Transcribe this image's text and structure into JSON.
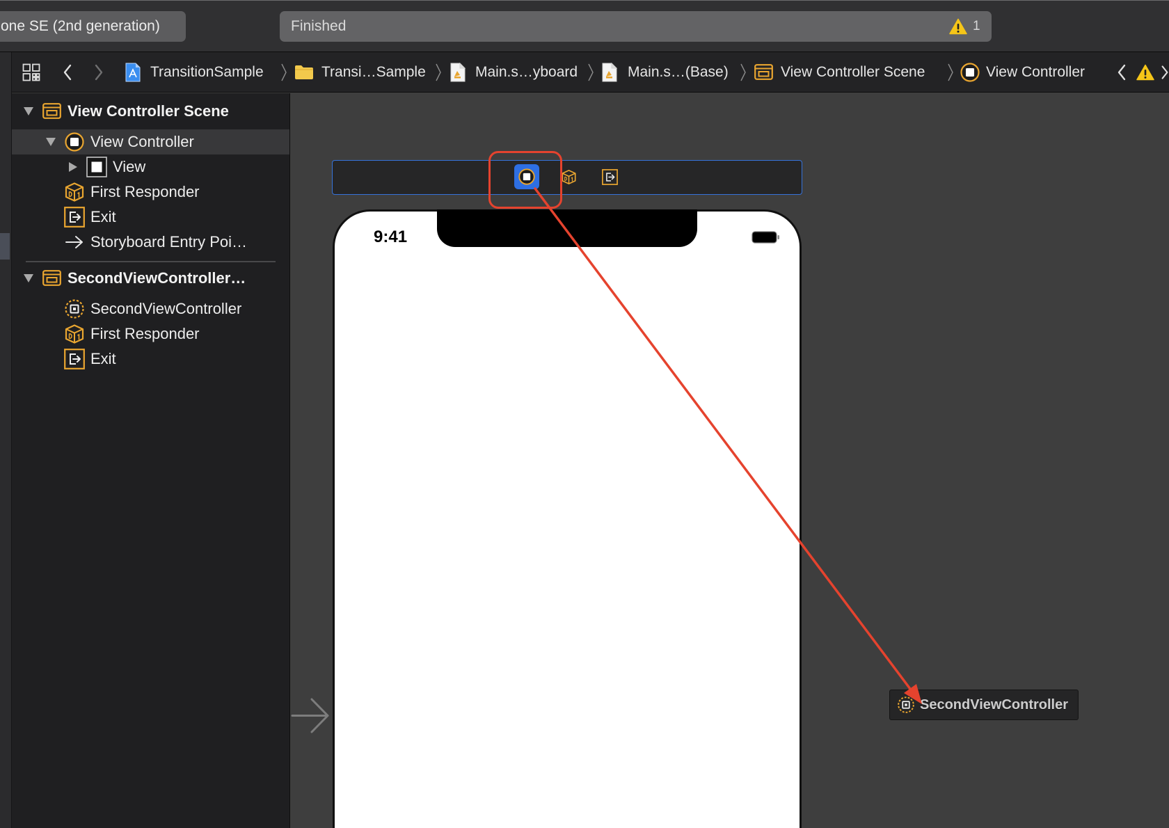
{
  "toolbar": {
    "scheme_label": "one SE (2nd generation)",
    "status_text": "Finished",
    "warning_count": "1",
    "warning_icon": "warning-icon"
  },
  "jump_bar": {
    "leading_icons": [
      "related-items-icon",
      "back-chevron-icon",
      "forward-chevron-icon"
    ],
    "path": [
      {
        "label": "TransitionSample",
        "icon": "project-icon"
      },
      {
        "label": "Transi…Sample",
        "icon": "folder-icon"
      },
      {
        "label": "Main.s…yboard",
        "icon": "storyboard-file-icon"
      },
      {
        "label": "Main.s…(Base)",
        "icon": "storyboard-file-icon"
      },
      {
        "label": "View Controller Scene",
        "icon": "scene-icon"
      },
      {
        "label": "View Controller",
        "icon": "view-controller-icon"
      }
    ],
    "trailing_icons": [
      "previous-issue-icon",
      "warning-icon",
      "next-issue-icon"
    ]
  },
  "outline": {
    "scenes": [
      {
        "title": "View Controller Scene",
        "icon": "scene-icon",
        "expanded": true,
        "items": [
          {
            "label": "View Controller",
            "icon": "view-controller-icon",
            "selected": true,
            "expanded": true
          },
          {
            "label": "View",
            "icon": "view-icon",
            "expanded": false
          },
          {
            "label": "First Responder",
            "icon": "first-responder-icon"
          },
          {
            "label": "Exit",
            "icon": "exit-icon"
          },
          {
            "label": "Storyboard Entry Poi…",
            "icon": "entry-point-arrow-icon"
          }
        ]
      },
      {
        "title": "SecondViewController…",
        "icon": "scene-icon",
        "expanded": true,
        "items": [
          {
            "label": "SecondViewController",
            "icon": "custom-view-controller-icon"
          },
          {
            "label": "First Responder",
            "icon": "first-responder-icon"
          },
          {
            "label": "Exit",
            "icon": "exit-icon"
          }
        ]
      }
    ]
  },
  "canvas": {
    "scene_dock_icons": [
      "view-controller-icon",
      "first-responder-icon",
      "exit-icon"
    ],
    "selected_dock_icon": "view-controller-icon",
    "device_time": "9:41",
    "drop_target_label": "SecondViewController",
    "drop_target_icon": "custom-view-controller-icon"
  },
  "colors": {
    "selection_blue": "#2e6fe3",
    "dock_border_blue": "#3572da",
    "scene_icon_orange": "#eaa630",
    "warning_yellow": "#f5c518",
    "annotation_red": "#e5432e",
    "canvas_background": "#3e3e3e",
    "outline_background": "#1f1f21"
  }
}
